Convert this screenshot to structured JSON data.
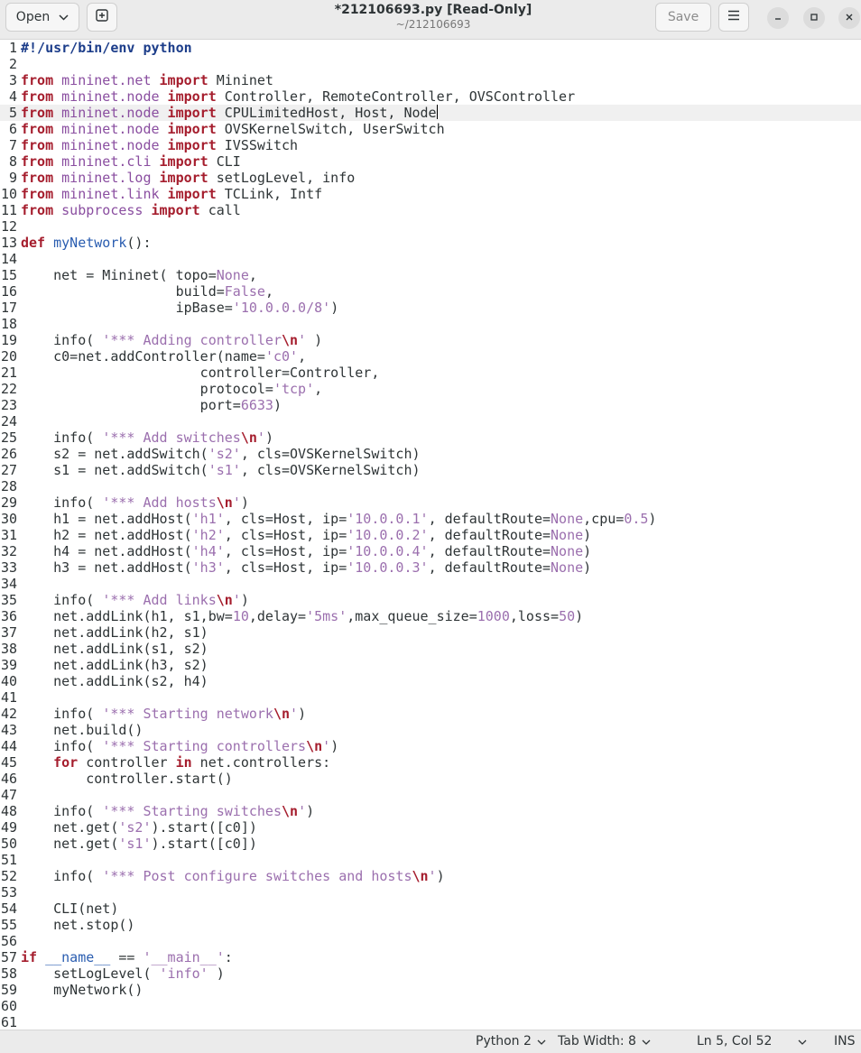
{
  "header": {
    "open_label": "Open",
    "title": "*212106693.py [Read-Only]",
    "subtitle": "~/212106693",
    "save_label": "Save"
  },
  "editor": {
    "current_line": 5,
    "lines": [
      [
        [
          "pre",
          "#!/usr/bin/env python"
        ]
      ],
      [],
      [
        [
          "kw",
          "from "
        ],
        [
          "mod",
          "mininet.net"
        ],
        [
          "kw",
          " import "
        ],
        [
          "",
          "Mininet"
        ]
      ],
      [
        [
          "kw",
          "from "
        ],
        [
          "mod",
          "mininet.node"
        ],
        [
          "kw",
          " import "
        ],
        [
          "",
          "Controller, RemoteController, OVSController"
        ]
      ],
      [
        [
          "kw",
          "from "
        ],
        [
          "mod",
          "mininet.node"
        ],
        [
          "kw",
          " import "
        ],
        [
          "",
          "CPULimitedHost, Host, Node"
        ]
      ],
      [
        [
          "kw",
          "from "
        ],
        [
          "mod",
          "mininet.node"
        ],
        [
          "kw",
          " import "
        ],
        [
          "",
          "OVSKernelSwitch, UserSwitch"
        ]
      ],
      [
        [
          "kw",
          "from "
        ],
        [
          "mod",
          "mininet.node"
        ],
        [
          "kw",
          " import "
        ],
        [
          "",
          "IVSSwitch"
        ]
      ],
      [
        [
          "kw",
          "from "
        ],
        [
          "mod",
          "mininet.cli"
        ],
        [
          "kw",
          " import "
        ],
        [
          "",
          "CLI"
        ]
      ],
      [
        [
          "kw",
          "from "
        ],
        [
          "mod",
          "mininet.log"
        ],
        [
          "kw",
          " import "
        ],
        [
          "",
          "setLogLevel, info"
        ]
      ],
      [
        [
          "kw",
          "from "
        ],
        [
          "mod",
          "mininet.link"
        ],
        [
          "kw",
          " import "
        ],
        [
          "",
          "TCLink, Intf"
        ]
      ],
      [
        [
          "kw",
          "from "
        ],
        [
          "mod",
          "subprocess"
        ],
        [
          "kw",
          " import "
        ],
        [
          "",
          "call"
        ]
      ],
      [],
      [
        [
          "kw",
          "def "
        ],
        [
          "fn",
          "myNetwork"
        ],
        [
          "",
          "():"
        ]
      ],
      [],
      [
        [
          "",
          "    net = Mininet( topo="
        ],
        [
          "const",
          "None"
        ],
        [
          "",
          ","
        ]
      ],
      [
        [
          "",
          "                   build="
        ],
        [
          "const",
          "False"
        ],
        [
          "",
          ","
        ]
      ],
      [
        [
          "",
          "                   ipBase="
        ],
        [
          "str",
          "'10.0.0.0/8'"
        ],
        [
          "",
          ")"
        ]
      ],
      [],
      [
        [
          "",
          "    info( "
        ],
        [
          "str",
          "'*** Adding controller"
        ],
        [
          "esc",
          "\\n"
        ],
        [
          "str",
          "'"
        ],
        [
          "",
          " )"
        ]
      ],
      [
        [
          "",
          "    c0=net.addController(name="
        ],
        [
          "str",
          "'c0'"
        ],
        [
          "",
          ","
        ]
      ],
      [
        [
          "",
          "                      controller=Controller,"
        ]
      ],
      [
        [
          "",
          "                      protocol="
        ],
        [
          "str",
          "'tcp'"
        ],
        [
          "",
          ","
        ]
      ],
      [
        [
          "",
          "                      port="
        ],
        [
          "num",
          "6633"
        ],
        [
          "",
          ")"
        ]
      ],
      [],
      [
        [
          "",
          "    info( "
        ],
        [
          "str",
          "'*** Add switches"
        ],
        [
          "esc",
          "\\n"
        ],
        [
          "str",
          "'"
        ],
        [
          "",
          ")"
        ]
      ],
      [
        [
          "",
          "    s2 = net.addSwitch("
        ],
        [
          "str",
          "'s2'"
        ],
        [
          "",
          ", cls=OVSKernelSwitch)"
        ]
      ],
      [
        [
          "",
          "    s1 = net.addSwitch("
        ],
        [
          "str",
          "'s1'"
        ],
        [
          "",
          ", cls=OVSKernelSwitch)"
        ]
      ],
      [],
      [
        [
          "",
          "    info( "
        ],
        [
          "str",
          "'*** Add hosts"
        ],
        [
          "esc",
          "\\n"
        ],
        [
          "str",
          "'"
        ],
        [
          "",
          ")"
        ]
      ],
      [
        [
          "",
          "    h1 = net.addHost("
        ],
        [
          "str",
          "'h1'"
        ],
        [
          "",
          ", cls=Host, ip="
        ],
        [
          "str",
          "'10.0.0.1'"
        ],
        [
          "",
          ", defaultRoute="
        ],
        [
          "const",
          "None"
        ],
        [
          "",
          ",cpu="
        ],
        [
          "num",
          "0.5"
        ],
        [
          "",
          ")"
        ]
      ],
      [
        [
          "",
          "    h2 = net.addHost("
        ],
        [
          "str",
          "'h2'"
        ],
        [
          "",
          ", cls=Host, ip="
        ],
        [
          "str",
          "'10.0.0.2'"
        ],
        [
          "",
          ", defaultRoute="
        ],
        [
          "const",
          "None"
        ],
        [
          "",
          ")"
        ]
      ],
      [
        [
          "",
          "    h4 = net.addHost("
        ],
        [
          "str",
          "'h4'"
        ],
        [
          "",
          ", cls=Host, ip="
        ],
        [
          "str",
          "'10.0.0.4'"
        ],
        [
          "",
          ", defaultRoute="
        ],
        [
          "const",
          "None"
        ],
        [
          "",
          ")"
        ]
      ],
      [
        [
          "",
          "    h3 = net.addHost("
        ],
        [
          "str",
          "'h3'"
        ],
        [
          "",
          ", cls=Host, ip="
        ],
        [
          "str",
          "'10.0.0.3'"
        ],
        [
          "",
          ", defaultRoute="
        ],
        [
          "const",
          "None"
        ],
        [
          "",
          ")"
        ]
      ],
      [],
      [
        [
          "",
          "    info( "
        ],
        [
          "str",
          "'*** Add links"
        ],
        [
          "esc",
          "\\n"
        ],
        [
          "str",
          "'"
        ],
        [
          "",
          ")"
        ]
      ],
      [
        [
          "",
          "    net.addLink(h1, s1,bw="
        ],
        [
          "num",
          "10"
        ],
        [
          "",
          ",delay="
        ],
        [
          "str",
          "'5ms'"
        ],
        [
          "",
          ",max_queue_size="
        ],
        [
          "num",
          "1000"
        ],
        [
          "",
          ",loss="
        ],
        [
          "num",
          "50"
        ],
        [
          "",
          ")"
        ]
      ],
      [
        [
          "",
          "    net.addLink(h2, s1)"
        ]
      ],
      [
        [
          "",
          "    net.addLink(s1, s2)"
        ]
      ],
      [
        [
          "",
          "    net.addLink(h3, s2)"
        ]
      ],
      [
        [
          "",
          "    net.addLink(s2, h4)"
        ]
      ],
      [],
      [
        [
          "",
          "    info( "
        ],
        [
          "str",
          "'*** Starting network"
        ],
        [
          "esc",
          "\\n"
        ],
        [
          "str",
          "'"
        ],
        [
          "",
          ")"
        ]
      ],
      [
        [
          "",
          "    net.build()"
        ]
      ],
      [
        [
          "",
          "    info( "
        ],
        [
          "str",
          "'*** Starting controllers"
        ],
        [
          "esc",
          "\\n"
        ],
        [
          "str",
          "'"
        ],
        [
          "",
          ")"
        ]
      ],
      [
        [
          "",
          "    "
        ],
        [
          "kw",
          "for"
        ],
        [
          "",
          " controller "
        ],
        [
          "kw",
          "in"
        ],
        [
          "",
          " net.controllers:"
        ]
      ],
      [
        [
          "",
          "        controller.start()"
        ]
      ],
      [],
      [
        [
          "",
          "    info( "
        ],
        [
          "str",
          "'*** Starting switches"
        ],
        [
          "esc",
          "\\n"
        ],
        [
          "str",
          "'"
        ],
        [
          "",
          ")"
        ]
      ],
      [
        [
          "",
          "    net.get("
        ],
        [
          "str",
          "'s2'"
        ],
        [
          "",
          ").start([c0])"
        ]
      ],
      [
        [
          "",
          "    net.get("
        ],
        [
          "str",
          "'s1'"
        ],
        [
          "",
          ").start([c0])"
        ]
      ],
      [],
      [
        [
          "",
          "    info( "
        ],
        [
          "str",
          "'*** Post configure switches and hosts"
        ],
        [
          "esc",
          "\\n"
        ],
        [
          "str",
          "'"
        ],
        [
          "",
          ")"
        ]
      ],
      [],
      [
        [
          "",
          "    CLI(net)"
        ]
      ],
      [
        [
          "",
          "    net.stop()"
        ]
      ],
      [],
      [
        [
          "kw",
          "if"
        ],
        [
          "",
          " "
        ],
        [
          "fn",
          "__name__"
        ],
        [
          "",
          " == "
        ],
        [
          "str",
          "'__main__'"
        ],
        [
          "",
          ":"
        ]
      ],
      [
        [
          "",
          "    setLogLevel( "
        ],
        [
          "str",
          "'info'"
        ],
        [
          "",
          " )"
        ]
      ],
      [
        [
          "",
          "    myNetwork()"
        ]
      ],
      [],
      []
    ]
  },
  "statusbar": {
    "language": "Python 2",
    "tab_width": "Tab Width: 8",
    "position": "Ln 5, Col 52",
    "mode": "INS"
  }
}
